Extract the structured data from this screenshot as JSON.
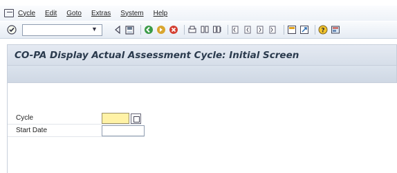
{
  "menu": {
    "items": [
      "Cycle",
      "Edit",
      "Goto",
      "Extras",
      "System",
      "Help"
    ]
  },
  "toolbar": {
    "command_field_value": "",
    "icons": [
      "enter-icon",
      "command-dropdown-icon",
      "back-arrow-icon",
      "save-icon",
      "back-icon",
      "exit-icon",
      "cancel-icon",
      "print-icon",
      "find-icon",
      "find-next-icon",
      "first-page-icon",
      "previous-page-icon",
      "next-page-icon",
      "last-page-icon",
      "create-session-icon",
      "shortcut-icon",
      "help-icon",
      "customize-layout-icon"
    ]
  },
  "screen": {
    "title": "CO-PA Display Actual Assessment Cycle: Initial Screen"
  },
  "form": {
    "cycle_label": "Cycle",
    "cycle_value": "",
    "start_date_label": "Start Date",
    "start_date_value": ""
  },
  "colors": {
    "title": "#2a3a4d",
    "required_field": "#fff2a6",
    "toolbar": "#e6ecf4"
  }
}
